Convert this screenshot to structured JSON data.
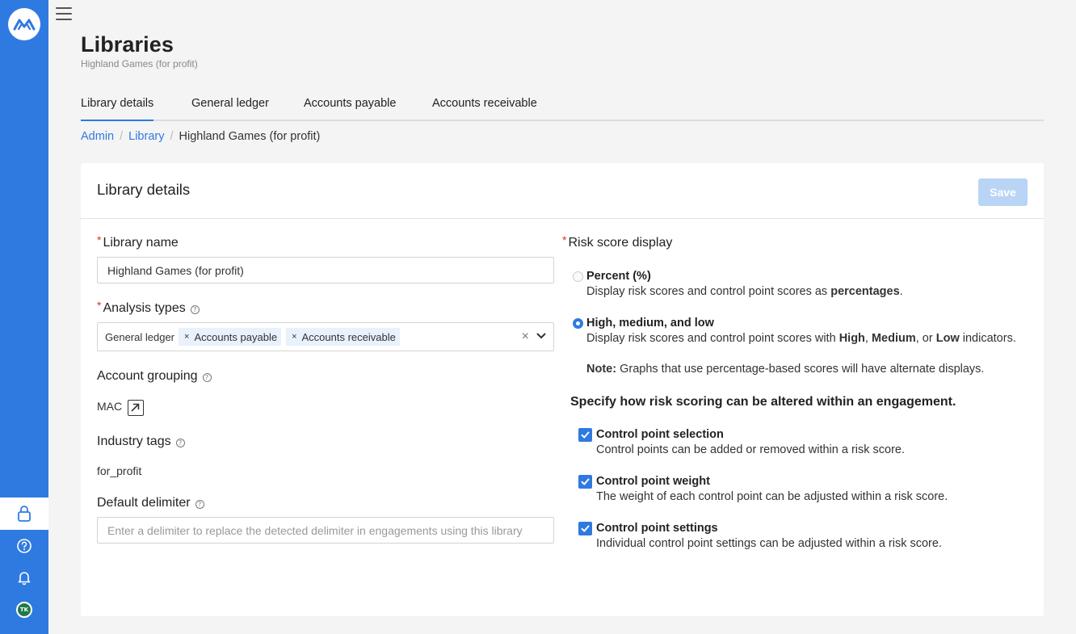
{
  "nav": {
    "icons": [
      "logo-icon",
      "menu-icon",
      "lock-icon",
      "help-icon",
      "bell-icon"
    ],
    "avatar_initials": "TK"
  },
  "page": {
    "title": "Libraries",
    "subtitle": "Highland Games (for profit)"
  },
  "tabs": [
    {
      "label": "Library details",
      "active": true
    },
    {
      "label": "General ledger"
    },
    {
      "label": "Accounts payable"
    },
    {
      "label": "Accounts receivable"
    }
  ],
  "breadcrumb": {
    "items": [
      "Admin",
      "Library"
    ],
    "separator": "/",
    "current": "Highland Games (for profit)"
  },
  "card": {
    "title": "Library details",
    "save_label": "Save"
  },
  "form": {
    "library_name": {
      "label": "Library name",
      "value": "Highland Games (for profit)"
    },
    "analysis_types": {
      "label": "Analysis types",
      "chips": [
        "General ledger",
        "Accounts payable",
        "Accounts receivable"
      ],
      "remove_glyph": "×",
      "clear_glyph": "×"
    },
    "account_grouping": {
      "label": "Account grouping",
      "value": "MAC"
    },
    "industry_tags": {
      "label": "Industry tags",
      "value": "for_profit"
    },
    "default_delimiter": {
      "label": "Default delimiter",
      "placeholder": "Enter a delimiter to replace the detected delimiter in engagements using this library"
    },
    "help_glyph": "?",
    "required_glyph": "*"
  },
  "risk": {
    "label": "Risk score display",
    "options": [
      {
        "title": "Percent (%)",
        "desc_pre": "Display risk scores and control point scores as ",
        "desc_bold": "percentages",
        "desc_post": ".",
        "selected": false
      },
      {
        "title": "High, medium, and low",
        "desc_pre": "Display risk scores and control point scores with ",
        "b1": "High",
        "s1": ", ",
        "b2": "Medium",
        "s2": ", or ",
        "b3": "Low",
        "desc_post": " indicators.",
        "selected": true
      }
    ],
    "note_label": "Note:",
    "note_text": " Graphs that use percentage-based scores will have alternate displays.",
    "alter_heading": "Specify how risk scoring can be altered within an engagement.",
    "checks": [
      {
        "title": "Control point selection",
        "desc": "Control points can be added or removed within a risk score.",
        "checked": true
      },
      {
        "title": "Control point weight",
        "desc": "The weight of each control point can be adjusted within a risk score.",
        "checked": true
      },
      {
        "title": "Control point settings",
        "desc": "Individual control point settings can be adjusted within a risk score.",
        "checked": true
      }
    ]
  },
  "colors": {
    "accent": "#2f7ae0",
    "rail": "#2f7ae0",
    "required": "#d9342b",
    "save_disabled": "#b9d4f5"
  }
}
